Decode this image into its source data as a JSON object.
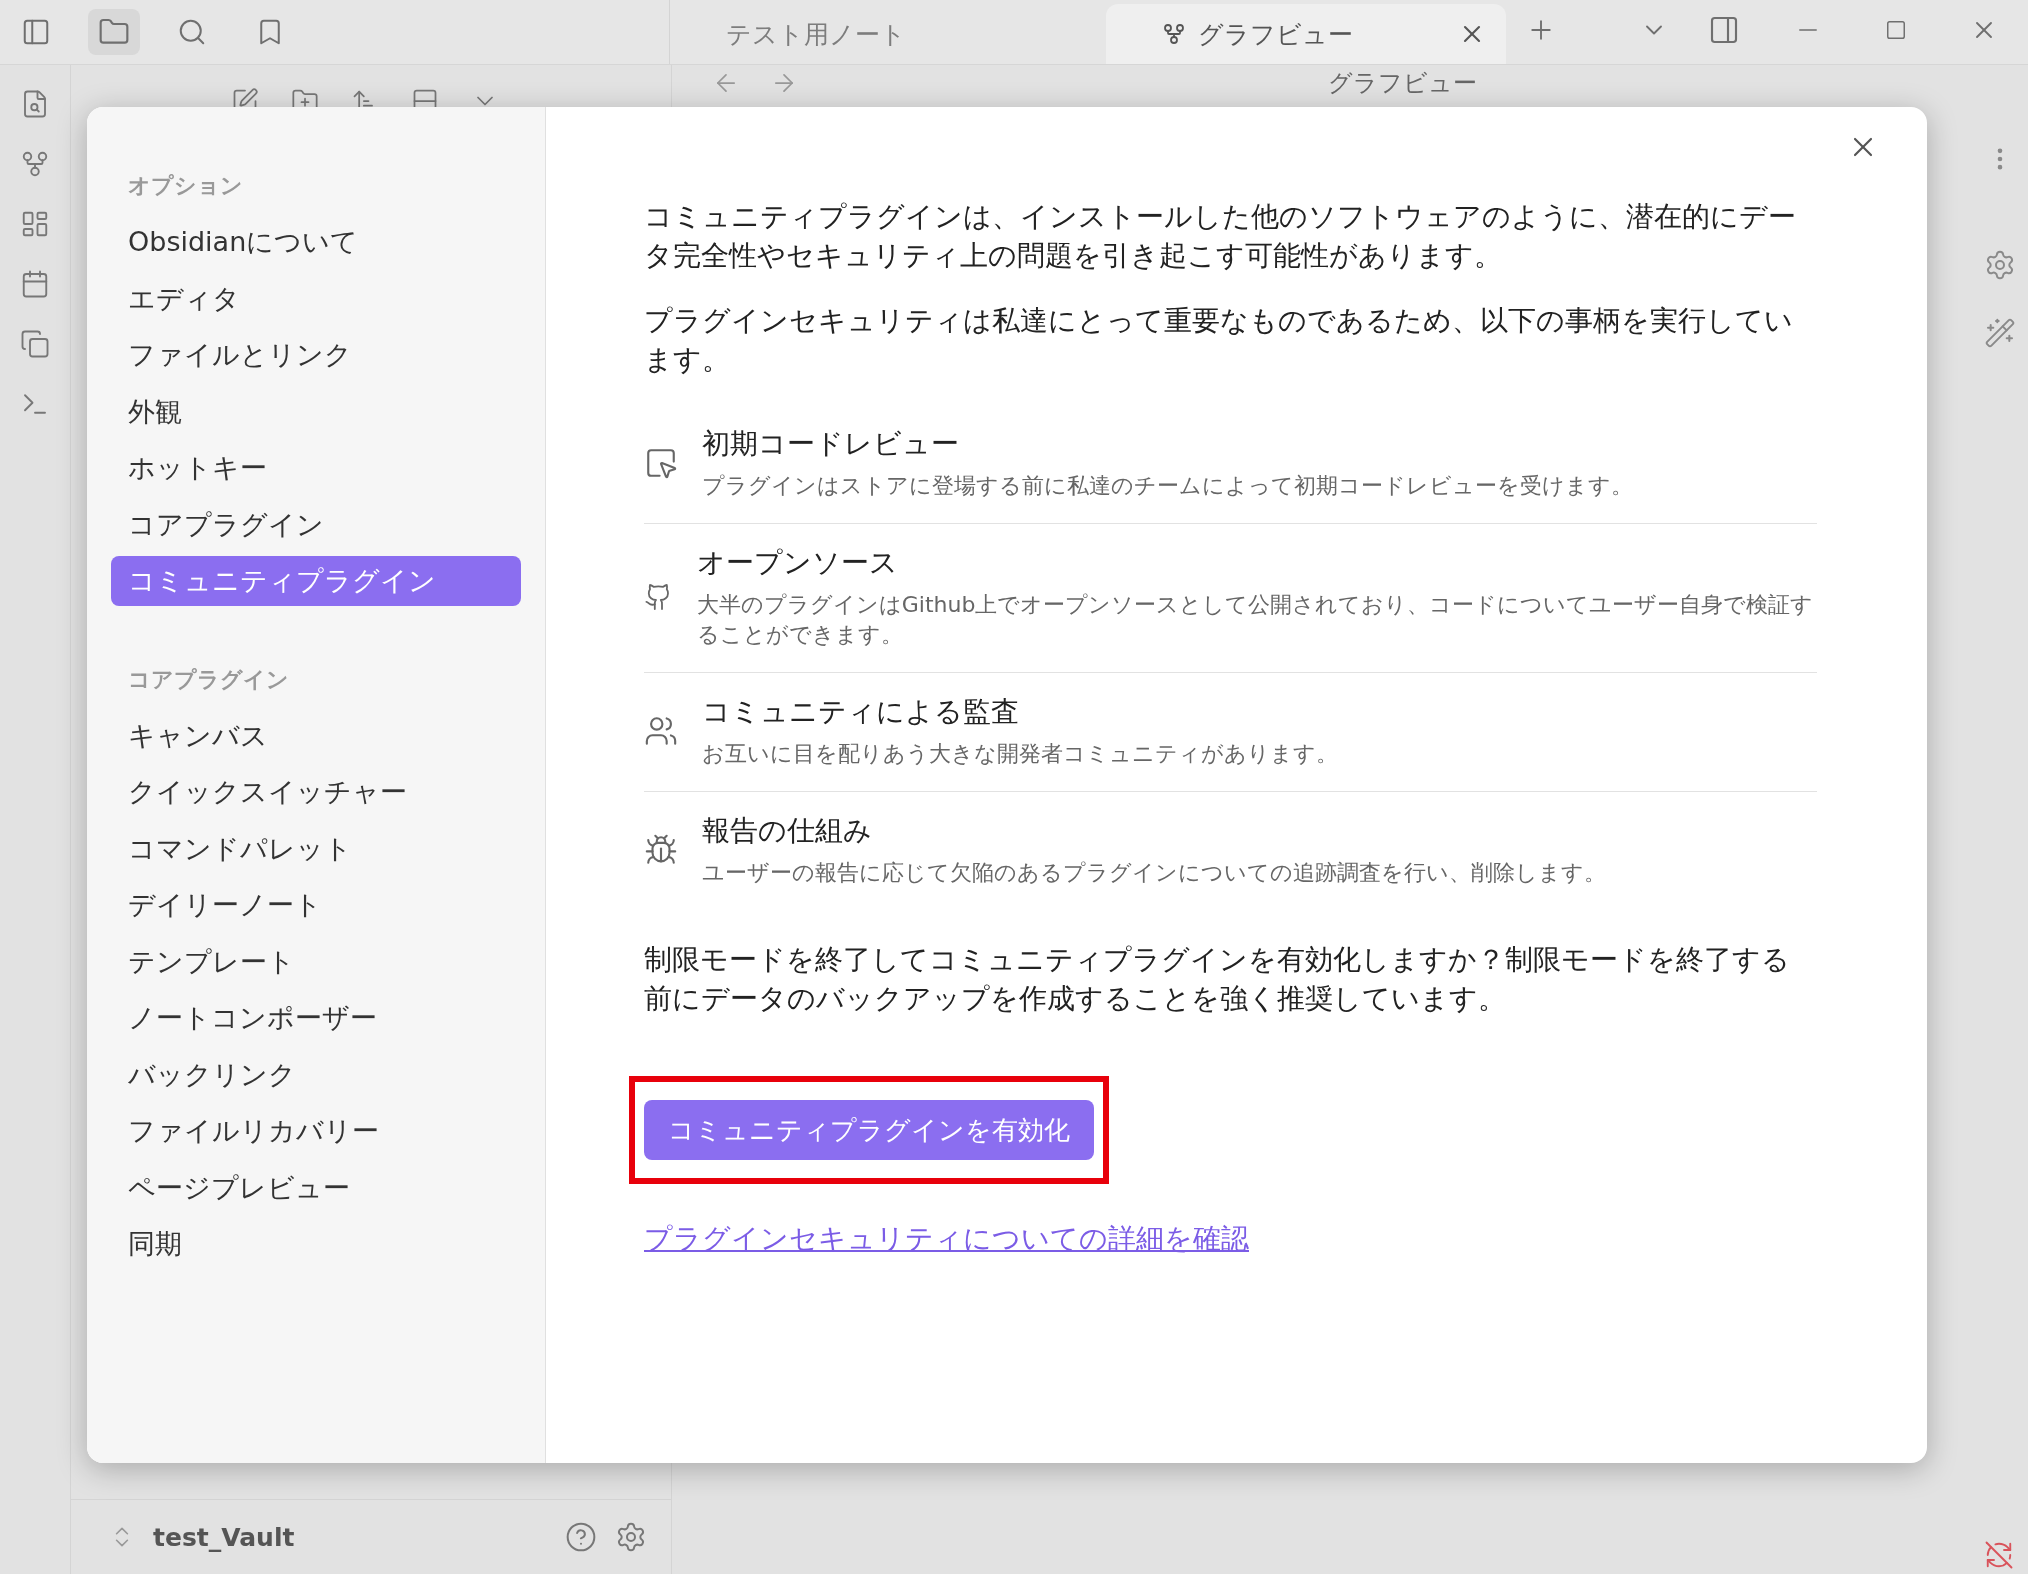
{
  "tabs": [
    {
      "label": "テスト用ノート",
      "selected": false
    },
    {
      "label": "グラフビュー",
      "selected": true
    }
  ],
  "view_header": {
    "title": "グラフビュー"
  },
  "vault": {
    "name": "test_Vault"
  },
  "settings": {
    "sidebar": [
      {
        "heading": "オプション",
        "items": [
          {
            "label": "Obsidianについて",
            "selected": false
          },
          {
            "label": "エディタ",
            "selected": false
          },
          {
            "label": "ファイルとリンク",
            "selected": false
          },
          {
            "label": "外観",
            "selected": false
          },
          {
            "label": "ホットキー",
            "selected": false
          },
          {
            "label": "コアプラグイン",
            "selected": false
          },
          {
            "label": "コミュニティプラグイン",
            "selected": true
          }
        ]
      },
      {
        "heading": "コアプラグイン",
        "items": [
          {
            "label": "キャンバス",
            "selected": false
          },
          {
            "label": "クイックスイッチャー",
            "selected": false
          },
          {
            "label": "コマンドパレット",
            "selected": false
          },
          {
            "label": "デイリーノート",
            "selected": false
          },
          {
            "label": "テンプレート",
            "selected": false
          },
          {
            "label": "ノートコンポーザー",
            "selected": false
          },
          {
            "label": "バックリンク",
            "selected": false
          },
          {
            "label": "ファイルリカバリー",
            "selected": false
          },
          {
            "label": "ページプレビュー",
            "selected": false
          },
          {
            "label": "同期",
            "selected": false
          }
        ]
      }
    ],
    "intro": [
      "コミュニティプラグインは、インストールした他のソフトウェアのように、潜在的にデータ完全性やセキュリティ上の問題を引き起こす可能性があります。",
      "プラグインセキュリティは私達にとって重要なものであるため、以下の事柄を実行しています。"
    ],
    "features": [
      {
        "title": "初期コードレビュー",
        "description": "プラグインはストアに登場する前に私達のチームによって初期コードレビューを受けます。"
      },
      {
        "title": "オープンソース",
        "description": "大半のプラグインはGithub上でオープンソースとして公開されており、コードについてユーザー自身で検証することができます。"
      },
      {
        "title": "コミュニティによる監査",
        "description": "お互いに目を配りあう大きな開発者コミュニティがあります。"
      },
      {
        "title": "報告の仕組み",
        "description": "ユーザーの報告に応じて欠陥のあるプラグインについての追跡調査を行い、削除します。"
      }
    ],
    "question": "制限モードを終了してコミュニティプラグインを有効化しますか？制限モードを終了する前にデータのバックアップを作成することを強く推奨しています。",
    "enable_button": "コミュニティプラグインを有効化",
    "link": "プラグインセキュリティについての詳細を確認"
  }
}
